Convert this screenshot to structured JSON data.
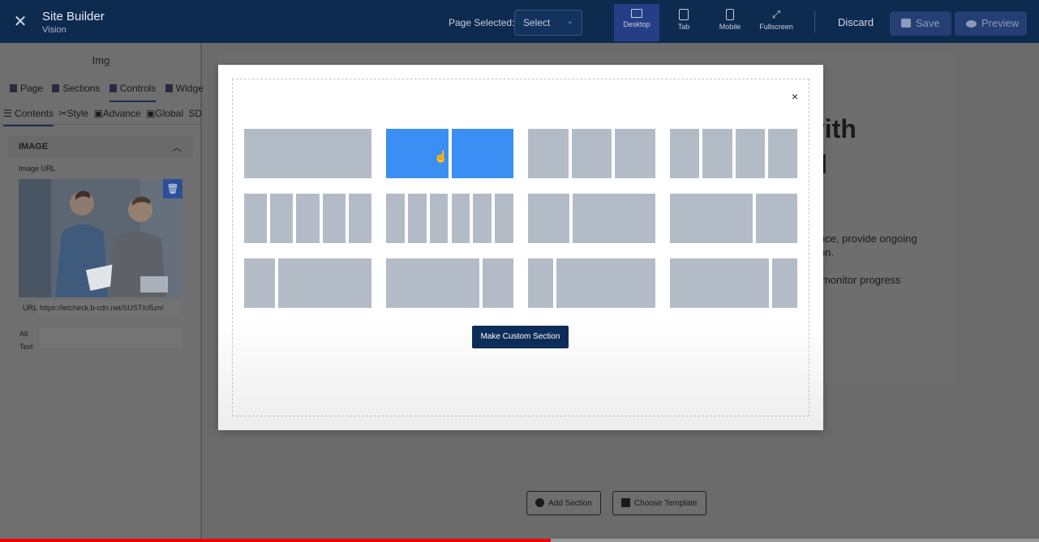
{
  "header": {
    "title": "Site Builder",
    "subtitle": "Vision",
    "page_selected_label": "Page Selected:",
    "page_select_value": "Select",
    "devices": [
      "Desktop",
      "Tab",
      "Mobile",
      "Fullscreen"
    ],
    "active_device": "Desktop",
    "discard_label": "Discard",
    "save_label": "Save",
    "preview_label": "Preview"
  },
  "left_panel": {
    "title": "Img",
    "tabs": [
      "Page",
      "Sections",
      "Controls",
      "Widgets"
    ],
    "active_tab": "Controls",
    "subtabs": [
      "Contents",
      "Style",
      "Advance",
      "Global",
      "SD"
    ],
    "active_subtab": "Contents",
    "section_label": "IMAGE",
    "image_url_label": "Image URL",
    "url_label": "URL",
    "url_value": "https://letcheck.b-cdn.net/SUST/cl5zn!",
    "alt_label": "Alt Text",
    "alt_value": ""
  },
  "page": {
    "heading_line1": "vith",
    "heading_line2": "l",
    "text_line1": "nce, provide ongoing",
    "text_line2": "on.",
    "text_line3": "monitor progress",
    "add_section_label": "Add Section",
    "choose_template_label": "Choose Template"
  },
  "modal": {
    "close_label": "×",
    "selected_layout": 2,
    "layouts": [
      {
        "id": 1,
        "columns": [
          1
        ]
      },
      {
        "id": 2,
        "columns": [
          1,
          1
        ]
      },
      {
        "id": 3,
        "columns": [
          1,
          1,
          1
        ]
      },
      {
        "id": 4,
        "columns": [
          1,
          1,
          1,
          1
        ]
      },
      {
        "id": 5,
        "columns": [
          1,
          1,
          1,
          1,
          1
        ]
      },
      {
        "id": 6,
        "columns": [
          1,
          1,
          1,
          1,
          1,
          1
        ]
      },
      {
        "id": 7,
        "columns": [
          1,
          2
        ]
      },
      {
        "id": 8,
        "columns": [
          2,
          1
        ]
      },
      {
        "id": 9,
        "columns": [
          1,
          3
        ]
      },
      {
        "id": 10,
        "columns": [
          3,
          1
        ]
      },
      {
        "id": 11,
        "columns": [
          1,
          4
        ]
      },
      {
        "id": 12,
        "columns": [
          4,
          1
        ]
      }
    ],
    "make_custom_label": "Make Custom Section"
  },
  "video_progress": 0.53,
  "colors": {
    "topbar": "#0d2a4f",
    "selected_layout": "#3b8ff4",
    "layout_block": "#b3bcc6",
    "custom_button": "#0c2d57"
  }
}
